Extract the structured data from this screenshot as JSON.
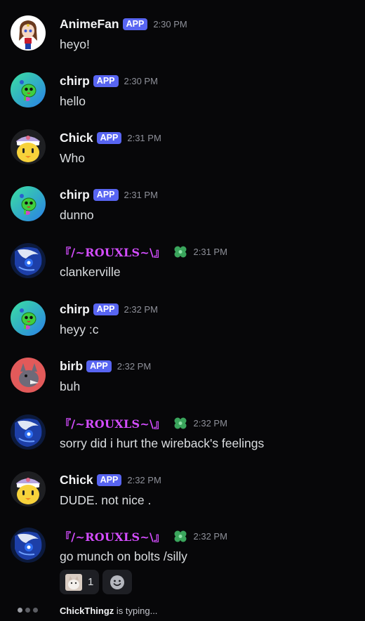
{
  "messages": [
    {
      "author": "AnimeFan",
      "badge": "APP",
      "time": "2:30 PM",
      "text": "heyo!",
      "avatar": "anime-girl-avatar"
    },
    {
      "author": "chirp",
      "badge": "APP",
      "time": "2:30 PM",
      "text": "hello",
      "avatar": "green-bird-avatar"
    },
    {
      "author": "Chick",
      "badge": "APP",
      "time": "2:31 PM",
      "text": "Who",
      "avatar": "yellow-chick-avatar"
    },
    {
      "author": "chirp",
      "badge": "APP",
      "time": "2:31 PM",
      "text": "dunno",
      "avatar": "green-bird-avatar"
    },
    {
      "author": "『/~ROUXLS~\\』",
      "time": "2:31 PM",
      "text": "clankerville",
      "avatar": "blue-mask-avatar",
      "role_icon": "green-clover-icon",
      "name_color": "#d44dff"
    },
    {
      "author": "chirp",
      "badge": "APP",
      "time": "2:32 PM",
      "text": "heyy :c",
      "avatar": "green-bird-avatar"
    },
    {
      "author": "birb",
      "badge": "APP",
      "time": "2:32 PM",
      "text": "buh",
      "avatar": "gray-bird-avatar"
    },
    {
      "author": "『/~ROUXLS~\\』",
      "time": "2:32 PM",
      "text": "sorry did i hurt the wireback's feelings",
      "avatar": "blue-mask-avatar",
      "role_icon": "green-clover-icon",
      "name_color": "#d44dff"
    },
    {
      "author": "Chick",
      "badge": "APP",
      "time": "2:32 PM",
      "text": "DUDE. not nice .",
      "avatar": "yellow-chick-avatar"
    },
    {
      "author": "『/~ROUXLS~\\』",
      "time": "2:32 PM",
      "text": "go munch on bolts /silly",
      "avatar": "blue-mask-avatar",
      "role_icon": "green-clover-icon",
      "name_color": "#d44dff"
    }
  ],
  "reactions": [
    {
      "emoji": "custom-cat-image",
      "count": "1"
    },
    {
      "emoji": "add-reaction-smiley-icon"
    }
  ],
  "typing": {
    "user": "ChickThingz",
    "suffix": " is typing..."
  },
  "colors": {
    "background": "#070709",
    "badge": "#5865f2",
    "fancy_name": "#d44dff"
  }
}
